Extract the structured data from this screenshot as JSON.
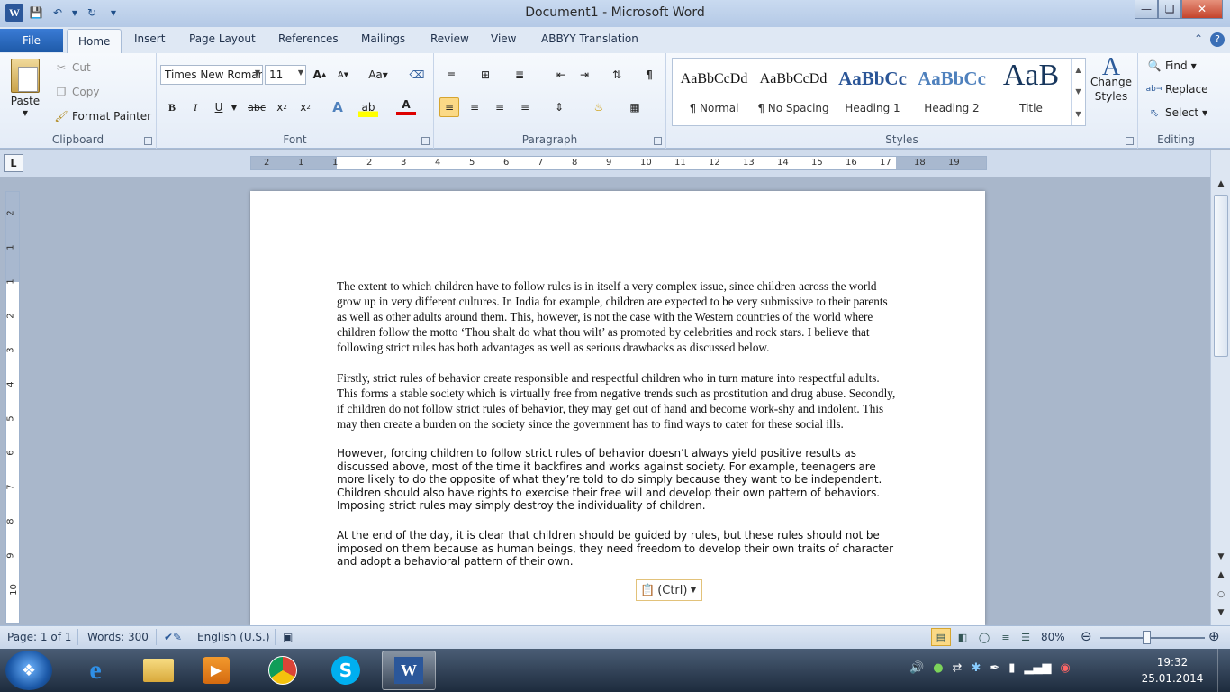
{
  "window": {
    "title": "Document1  -  Microsoft Word"
  },
  "tabs": {
    "file": "File",
    "items": [
      "Home",
      "Insert",
      "Page Layout",
      "References",
      "Mailings",
      "Review",
      "View",
      "ABBYY Translation"
    ]
  },
  "clipboard": {
    "paste": "Paste",
    "cut": "Cut",
    "copy": "Copy",
    "format_painter": "Format Painter",
    "label": "Clipboard"
  },
  "font": {
    "name": "Times New Roman",
    "size": "11",
    "label": "Font"
  },
  "paragraph": {
    "label": "Paragraph"
  },
  "styles": {
    "label": "Styles",
    "items": [
      {
        "sample": "AaBbCcDd",
        "name": "¶ Normal"
      },
      {
        "sample": "AaBbCcDd",
        "name": "¶ No Spacing"
      },
      {
        "sample": "AaBbCc",
        "name": "Heading 1"
      },
      {
        "sample": "AaBbCc",
        "name": "Heading 2"
      },
      {
        "sample": "AaB",
        "name": "Title"
      }
    ],
    "change_styles": "Change Styles"
  },
  "editing": {
    "find": "Find",
    "replace": "Replace",
    "select": "Select",
    "label": "Editing"
  },
  "ruler": {
    "h_numbers": [
      "2",
      "1",
      "1",
      "2",
      "3",
      "4",
      "5",
      "6",
      "7",
      "8",
      "9",
      "10",
      "11",
      "12",
      "13",
      "14",
      "15",
      "16",
      "17",
      "18",
      "19"
    ],
    "v_numbers": [
      "2",
      "1",
      "1",
      "2",
      "3",
      "4",
      "5",
      "6",
      "7",
      "8",
      "9",
      "10"
    ]
  },
  "document": {
    "paragraphs": [
      "The extent to which children have to follow rules is in itself a very complex issue, since children across the world grow up in very different cultures. In India for example, children are expected to be very submissive to their parents as well as other adults around them. This, however, is not the case with the Western countries of the world where children follow the motto ‘Thou shalt do what thou wilt’ as promoted by celebrities and rock stars. I believe that following strict rules has both advantages as well as serious drawbacks as discussed below.",
      "Firstly, strict rules of behavior create responsible and respectful children who in turn mature into respectful adults. This forms a stable society which is virtually free from negative trends such as prostitution and drug abuse. Secondly, if children do not follow strict rules of behavior, they may get out of hand and become work-shy and indolent. This may then create a burden on the society since the government has to find ways to cater for these social ills.",
      "However, forcing children to follow strict rules of behavior doesn’t always yield positive results as discussed above, most of the time it backfires and works against society. For example, teenagers are more likely to do the opposite of what they’re told to do simply because they want to be independent. Children should also have rights to exercise their free will and develop their own pattern of behaviors. Imposing strict rules may simply destroy the individuality of children.",
      "At the end of the day, it is clear that children should be guided by rules, but these rules should not be imposed on them because as human beings, they need freedom to develop their own traits of character and adopt a behavioral pattern of their own."
    ],
    "paste_options": "(Ctrl)"
  },
  "status": {
    "page": "Page: 1 of 1",
    "words": "Words: 300",
    "language": "English (U.S.)",
    "zoom": "80%",
    "zoom_fraction": 0.42
  },
  "taskbar": {
    "time": "19:32",
    "date": "25.01.2014"
  }
}
